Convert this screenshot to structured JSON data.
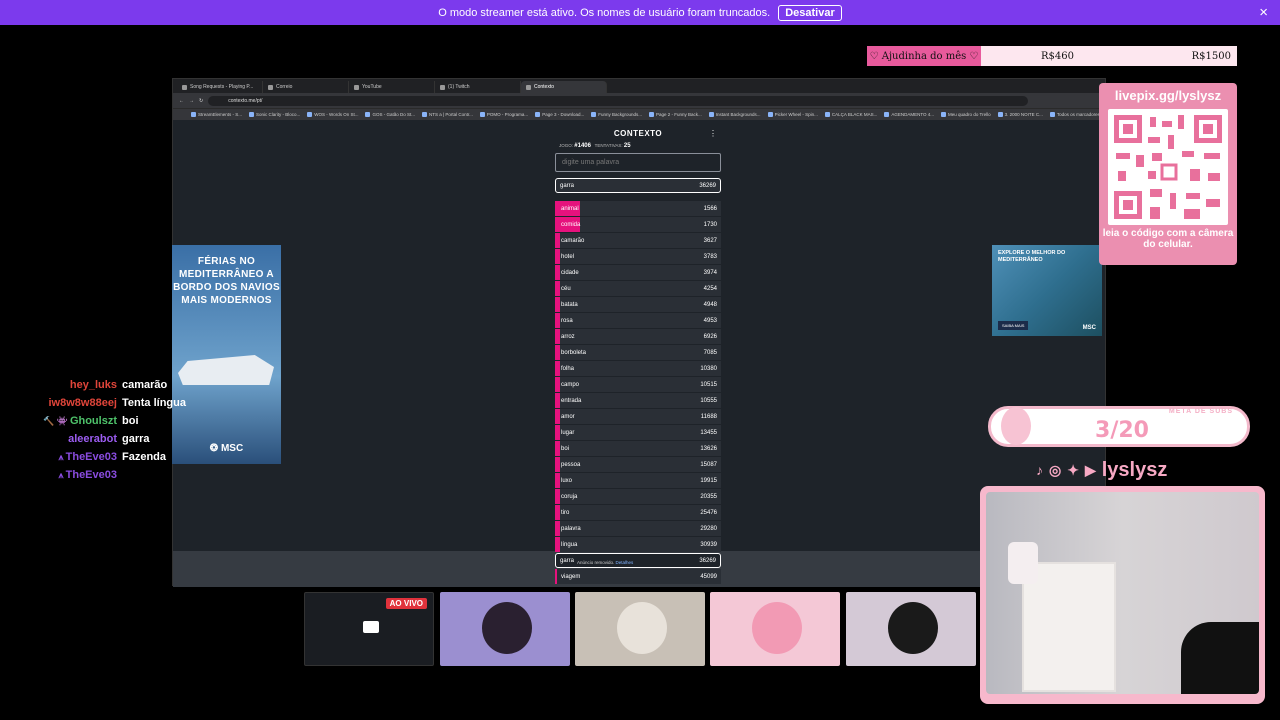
{
  "banner": {
    "text": "O modo streamer está ativo. Os nomes de usuário foram truncados.",
    "button": "Desativar",
    "close_glyph": "×"
  },
  "donation": {
    "label": "♡ Ajudinha do mês ♡",
    "current": "R$460",
    "goal": "R$1500",
    "progress_fraction": 0.0
  },
  "browser": {
    "tabs": [
      "Song Requests - Playing P...",
      "Correio",
      "YouTube",
      "(1) Twitch",
      "Contexto"
    ],
    "active_tab": "Contexto",
    "url": "contexto.me/pt/",
    "bookmarks": [
      "StreamElements - S...",
      "Sonic Clarity - Bloco...",
      "WOS - Words On St...",
      "GOS - Gatão Do St...",
      "NTS a | Portal Contr...",
      "POMO - Programa...",
      "Page 3 - Download...",
      "Funny Backgrounds...",
      "Page 2 - Funny Back...",
      "Instant Backgrounds...",
      "Picker Wheel - Spin...",
      "CALÇA BLACK MAS...",
      "AGENDAMENTO 4...",
      "Meu quadro do Trello",
      "3. 2000 NOITE C...",
      "Todos os marcadores"
    ]
  },
  "game": {
    "title": "CONTEXTO",
    "menu_glyph": "⋮",
    "game_label": "JOGO:",
    "game_number": "#1406",
    "attempts_label": "TENTATIVAS:",
    "attempts": "25",
    "input_placeholder": "digite uma palavra",
    "best": {
      "word": "garra",
      "rank": "36269"
    },
    "guesses": [
      {
        "word": "animal",
        "rank": "1566",
        "closeness": 0.14
      },
      {
        "word": "comida",
        "rank": "1730",
        "closeness": 0.14
      },
      {
        "word": "camarão",
        "rank": "3627",
        "closeness": 0.02
      },
      {
        "word": "hotel",
        "rank": "3783",
        "closeness": 0.02
      },
      {
        "word": "cidade",
        "rank": "3974",
        "closeness": 0.02
      },
      {
        "word": "céu",
        "rank": "4254",
        "closeness": 0.02
      },
      {
        "word": "batata",
        "rank": "4948",
        "closeness": 0.02
      },
      {
        "word": "rosa",
        "rank": "4953",
        "closeness": 0.02
      },
      {
        "word": "arroz",
        "rank": "6926",
        "closeness": 0.02
      },
      {
        "word": "borboleta",
        "rank": "7085",
        "closeness": 0.02
      },
      {
        "word": "folha",
        "rank": "10380",
        "closeness": 0.02
      },
      {
        "word": "campo",
        "rank": "10515",
        "closeness": 0.02
      },
      {
        "word": "entrada",
        "rank": "10555",
        "closeness": 0.02
      },
      {
        "word": "amor",
        "rank": "11688",
        "closeness": 0.02
      },
      {
        "word": "lugar",
        "rank": "13455",
        "closeness": 0.02
      },
      {
        "word": "boi",
        "rank": "13626",
        "closeness": 0.02
      },
      {
        "word": "pessoa",
        "rank": "15087",
        "closeness": 0.02
      },
      {
        "word": "luxo",
        "rank": "19915",
        "closeness": 0.02
      },
      {
        "word": "coruja",
        "rank": "20355",
        "closeness": 0.02
      },
      {
        "word": "tiro",
        "rank": "25476",
        "closeness": 0.02
      },
      {
        "word": "palavra",
        "rank": "29280",
        "closeness": 0.02
      },
      {
        "word": "língua",
        "rank": "30939",
        "closeness": 0.02
      }
    ],
    "pinned": {
      "word": "garra",
      "rank": "36269"
    },
    "last": {
      "word": "viagem",
      "rank": "45099"
    },
    "ad_notice": "Anúncio removido.",
    "ad_notice_link": "Detalhes"
  },
  "ad_left": {
    "text": "FÉRIAS NO MEDITERRÂNEO A BORDO DOS NAVIOS MAIS MODERNOS",
    "logo": "❂ MSC"
  },
  "ad_right": {
    "text": "EXPLORE O MELHOR DO MEDITERRÂNEO",
    "cta": "SAIBA MAIS",
    "logo": "MSC"
  },
  "qr": {
    "url": "livepix.gg/lyslysz",
    "caption": "leia o código com a câmera do celular."
  },
  "chat": [
    {
      "user": "hey_luks",
      "color": "#e0453a",
      "badges": "",
      "text": "camarão"
    },
    {
      "user": "iw8w8w88eej",
      "color": "#e0453a",
      "badges": "",
      "text": "Tenta língua"
    },
    {
      "user": "Ghoulszt",
      "color": "#4ec26a",
      "badges": "🔨 👾",
      "text": "boi"
    },
    {
      "user": "aleerabot",
      "color": "#9b5cf0",
      "badges": "",
      "text": "garra"
    },
    {
      "user": "TheEve03",
      "color": "#8a4ce0",
      "badges": "⩚",
      "text": "Fazenda"
    },
    {
      "user": "TheEve03",
      "color": "#8a4ce0",
      "badges": "⩚",
      "text": ""
    }
  ],
  "subgoal": {
    "label": "META DE SUBS",
    "value": "3/20",
    "progress": 0.15
  },
  "social": {
    "handle": "lyslysz",
    "icons": [
      "tiktok-icon",
      "instagram-icon",
      "twitter-icon",
      "youtube-icon"
    ]
  },
  "tiles": {
    "live_badge": "AO VIVO"
  },
  "colors": {
    "accent": "#7c3aed",
    "pink": "#eb8fb0",
    "contexto_bar": "#e6127d"
  }
}
